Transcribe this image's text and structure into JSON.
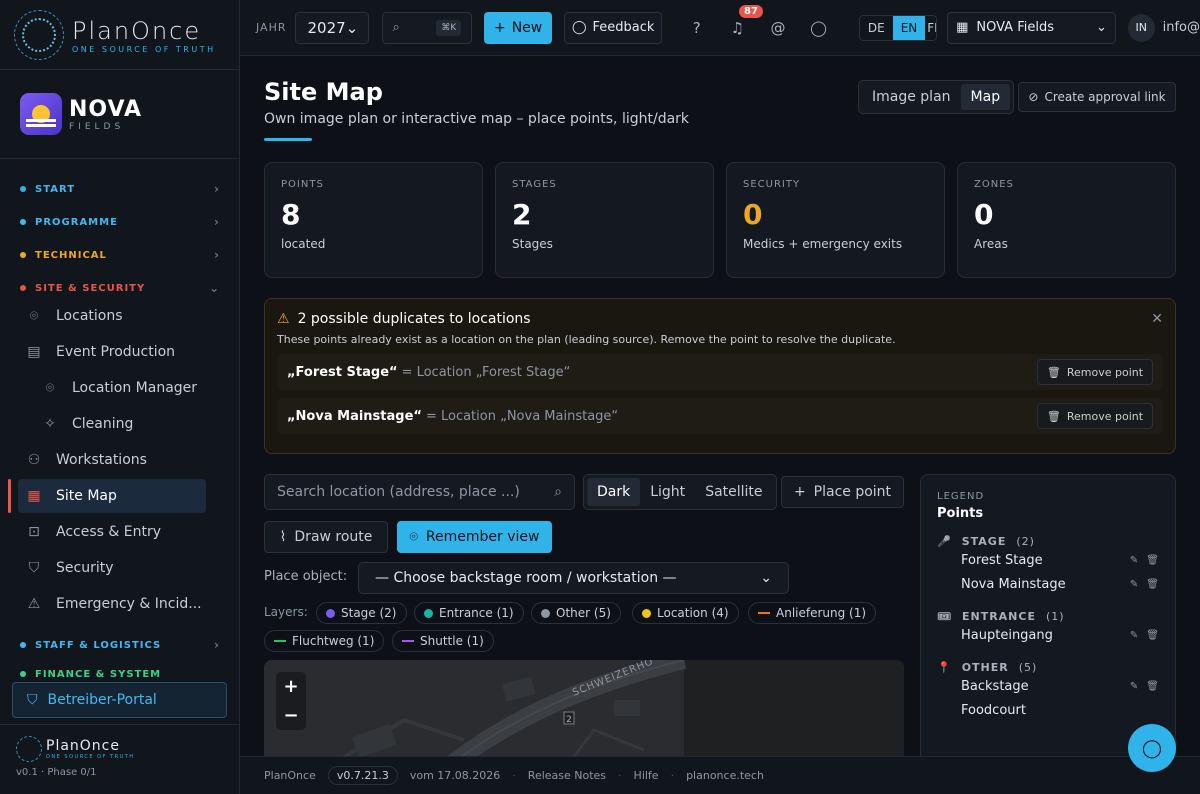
{
  "brand": {
    "name": "PlanOnce",
    "tagline": "ONE SOURCE OF TRUTH"
  },
  "project_logo": {
    "name": "NOVA",
    "sub": "FIELDS"
  },
  "topbar": {
    "year_label": "JAHR",
    "year": "2027",
    "search_shortcut": "⌘K",
    "new_label": "New",
    "feedback_label": "Feedback",
    "notifications": "87",
    "langs": [
      "DE",
      "EN",
      "FI"
    ],
    "active_lang": "EN",
    "project": "NOVA Fields",
    "avatar": "IN",
    "email": "info@"
  },
  "sidebar": {
    "sections": [
      {
        "label": "START",
        "color": "#2fb3e8"
      },
      {
        "label": "PROGRAMME",
        "color": "#41b9f0"
      },
      {
        "label": "TECHNICAL",
        "color": "#f0a623"
      },
      {
        "label": "SITE & SECURITY",
        "color": "#e8564b"
      },
      {
        "label": "STAFF & LOGISTICS",
        "color": "#41b9f0"
      },
      {
        "label": "FINANCE & SYSTEM",
        "color": "#3ad18b"
      }
    ],
    "items": [
      "Locations",
      "Event Production",
      "Location Manager",
      "Cleaning",
      "Workstations",
      "Site Map",
      "Access & Entry",
      "Security",
      "Emergency & Incid..."
    ],
    "portal": "Betreiber-Portal",
    "version": "v0.1 · Phase 0/1"
  },
  "page": {
    "title": "Site Map",
    "subtitle": "Own image plan or interactive map – place points, light/dark",
    "view_modes": [
      "Image plan",
      "Map"
    ],
    "active_view": "Map",
    "approval_label": "Create approval link"
  },
  "stats": [
    {
      "key": "POINTS",
      "value": "8",
      "desc": "located"
    },
    {
      "key": "STAGES",
      "value": "2",
      "desc": "Stages"
    },
    {
      "key": "SECURITY",
      "value": "0",
      "desc": "Medics + emergency exits",
      "warn": true
    },
    {
      "key": "ZONES",
      "value": "0",
      "desc": "Areas"
    }
  ],
  "duplicates": {
    "title": "2 possible duplicates to locations",
    "desc": "These points already exist as a location on the plan (leading source). Remove the point to resolve the duplicate.",
    "rows": [
      {
        "name": "„Forest Stage“",
        "eq": "= Location „Forest Stage“"
      },
      {
        "name": "„Nova Mainstage“",
        "eq": "= Location „Nova Mainstage“"
      }
    ],
    "remove_label": "Remove point"
  },
  "controls": {
    "search_placeholder": "Search location (address, place ...)",
    "themes": [
      "Dark",
      "Light",
      "Satellite"
    ],
    "active_theme": "Dark",
    "place_point": "Place point",
    "draw_route": "Draw route",
    "remember_view": "Remember view",
    "object_label": "Place object:",
    "object_value": "— Choose backstage room / workstation —",
    "layers_label": "Layers:"
  },
  "layers": [
    {
      "label": "Stage (2)",
      "color": "#7b5cf0",
      "kind": "dot"
    },
    {
      "label": "Entrance (1)",
      "color": "#14b8a6",
      "kind": "dot"
    },
    {
      "label": "Other (5)",
      "color": "#8e96a3",
      "kind": "dot"
    },
    {
      "label": "Location (4)",
      "color": "#f0c419",
      "kind": "dot"
    },
    {
      "label": "Anlieferung (1)",
      "color": "#f97316",
      "kind": "line"
    },
    {
      "label": "Fluchtweg (1)",
      "color": "#22c55e",
      "kind": "line"
    },
    {
      "label": "Shuttle (1)",
      "color": "#a855f7",
      "kind": "line"
    }
  ],
  "map": {
    "street": "SCHWEIZERHO",
    "zoom_in": "+",
    "zoom_out": "−",
    "marker": "2"
  },
  "legend": {
    "kicker": "LEGEND",
    "title": "Points",
    "groups": [
      {
        "icon": "🎤",
        "label": "STAGE",
        "count": "(2)",
        "items": [
          "Forest Stage",
          "Nova Mainstage"
        ]
      },
      {
        "icon": "🎟",
        "label": "ENTRANCE",
        "count": "(1)",
        "items": [
          "Haupteingang"
        ]
      },
      {
        "icon": "📍",
        "label": "OTHER",
        "count": "(5)",
        "items": [
          "Backstage",
          "Foodcourt"
        ]
      }
    ]
  },
  "footer": {
    "brand": "PlanOnce",
    "version": "v0.7.21.3",
    "date": "vom 17.08.2026",
    "links": [
      "Release Notes",
      "Hilfe",
      "planonce.tech"
    ]
  }
}
